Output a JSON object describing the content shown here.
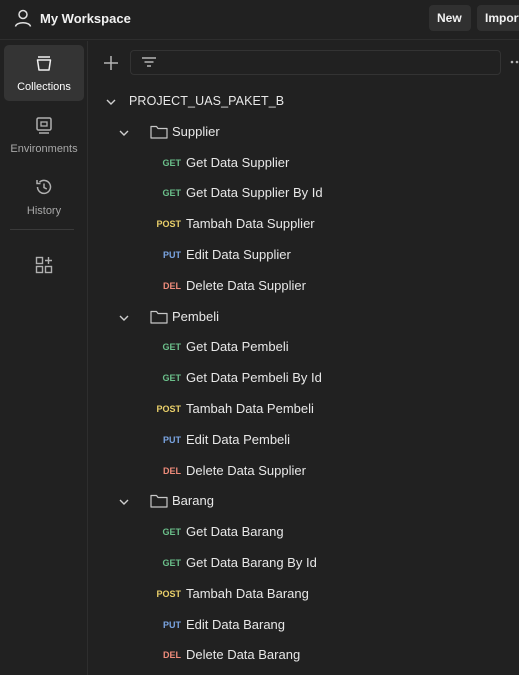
{
  "header": {
    "workspace_title": "My Workspace",
    "new_label": "New",
    "import_label": "Import"
  },
  "rail": {
    "collections": "Collections",
    "environments": "Environments",
    "history": "History"
  },
  "colors": {
    "background": "#212121",
    "active_rail": "#343434",
    "get": "#6bbf8a",
    "post": "#ead06a",
    "put": "#7aa5e3",
    "delete": "#ee8b7a"
  },
  "tree": {
    "collection": "PROJECT_UAS_PAKET_B",
    "folders": [
      {
        "name": "Supplier",
        "requests": [
          {
            "method": "GET",
            "name": "Get Data Supplier"
          },
          {
            "method": "GET",
            "name": "Get Data Supplier By Id"
          },
          {
            "method": "POST",
            "name": "Tambah Data Supplier"
          },
          {
            "method": "PUT",
            "name": "Edit Data Supplier"
          },
          {
            "method": "DEL",
            "name": "Delete Data Supplier"
          }
        ]
      },
      {
        "name": "Pembeli",
        "requests": [
          {
            "method": "GET",
            "name": "Get Data Pembeli"
          },
          {
            "method": "GET",
            "name": "Get Data Pembeli By Id"
          },
          {
            "method": "POST",
            "name": "Tambah Data Pembeli"
          },
          {
            "method": "PUT",
            "name": "Edit Data Pembeli"
          },
          {
            "method": "DEL",
            "name": "Delete Data Supplier"
          }
        ]
      },
      {
        "name": "Barang",
        "requests": [
          {
            "method": "GET",
            "name": "Get Data Barang"
          },
          {
            "method": "GET",
            "name": "Get Data Barang By Id"
          },
          {
            "method": "POST",
            "name": "Tambah Data Barang"
          },
          {
            "method": "PUT",
            "name": "Edit Data Barang"
          },
          {
            "method": "DEL",
            "name": "Delete Data Barang"
          }
        ]
      }
    ]
  }
}
